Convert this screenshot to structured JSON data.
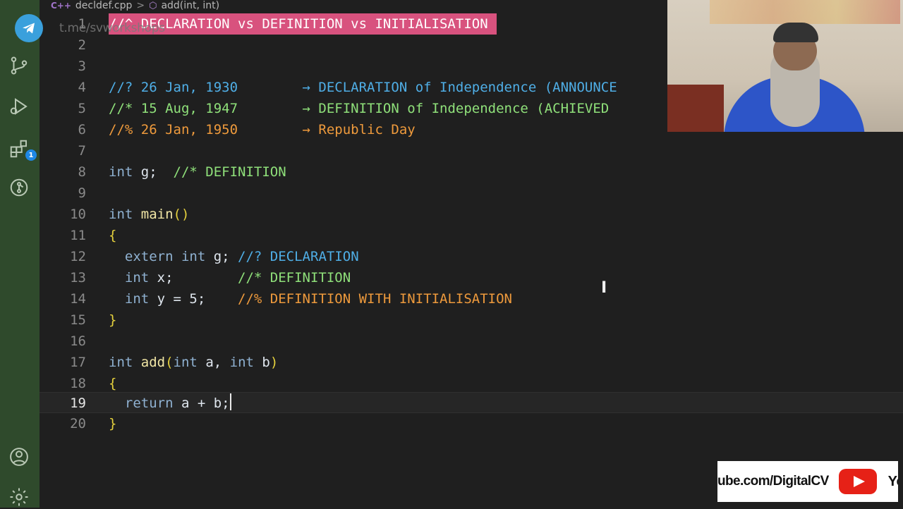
{
  "breadcrumb": {
    "file_icon": "C++",
    "file": "decldef.cpp",
    "separator": ">",
    "symbol": "add(int, int)"
  },
  "watermark": "t.me/svworkshops",
  "activity_bar": {
    "items": [
      "telegram-icon",
      "source-control-icon",
      "run-debug-icon",
      "extensions-icon",
      "git-graph-icon",
      "account-icon",
      "settings-gear-icon"
    ],
    "extensions_badge": "1"
  },
  "editor": {
    "lines": [
      {
        "n": "1"
      },
      {
        "n": "2"
      },
      {
        "n": "3"
      },
      {
        "n": "4"
      },
      {
        "n": "5"
      },
      {
        "n": "6"
      },
      {
        "n": "7"
      },
      {
        "n": "8"
      },
      {
        "n": "9"
      },
      {
        "n": "10"
      },
      {
        "n": "11"
      },
      {
        "n": "12"
      },
      {
        "n": "13"
      },
      {
        "n": "14"
      },
      {
        "n": "15"
      },
      {
        "n": "16"
      },
      {
        "n": "17"
      },
      {
        "n": "18"
      },
      {
        "n": "19"
      },
      {
        "n": "20"
      }
    ],
    "l1": "//^ DECLARATION vs DEFINITION vs INITIALISATION",
    "l4a": "//? 26 Jan, 1930        ",
    "l4b": "→ DECLARATION of Independence (ANNOUNCE",
    "l5a": "//* 15 Aug, 1947        ",
    "l5b": "→ DEFINITION of Independence (ACHIEVED",
    "l6a": "//% 26 Jan, 1950        ",
    "l6b": "→ Republic Day",
    "l8_kw": "int",
    "l8_id": " g;",
    "l8_c": "  //* DEFINITION",
    "l10_kw": "int",
    "l10_fn": " main",
    "l10_p": "()",
    "l11": "{",
    "l12_kw": "  extern int",
    "l12_id": " g;",
    "l12_c": " //? DECLARATION",
    "l13_kw": "  int",
    "l13_id": " x;",
    "l13_c": "        //* DEFINITION",
    "l14_kw": "  int",
    "l14_id": " y = 5;",
    "l14_c": "    //% DEFINITION WITH INITIALISATION",
    "l15": "}",
    "l17_kw": "int",
    "l17_fn": " add",
    "l17_p1": "(",
    "l17_k2": "int",
    "l17_i2": " a, ",
    "l17_k3": "int",
    "l17_i3": " b",
    "l17_p2": ")",
    "l18": "{",
    "l19_kw": "  return",
    "l19_id": " a + b;",
    "l20": "}",
    "current_line": "19"
  },
  "youtube": {
    "url": "ube.com/DigitalCV",
    "word": "YouT"
  },
  "colors": {
    "activity_bar": "#2f4a2c",
    "editor_bg": "#1f1f1f",
    "highlight_pink": "#d8527e",
    "comment_blue": "#4faee6",
    "comment_green": "#8fe07a",
    "comment_orange": "#ee9a3c"
  }
}
